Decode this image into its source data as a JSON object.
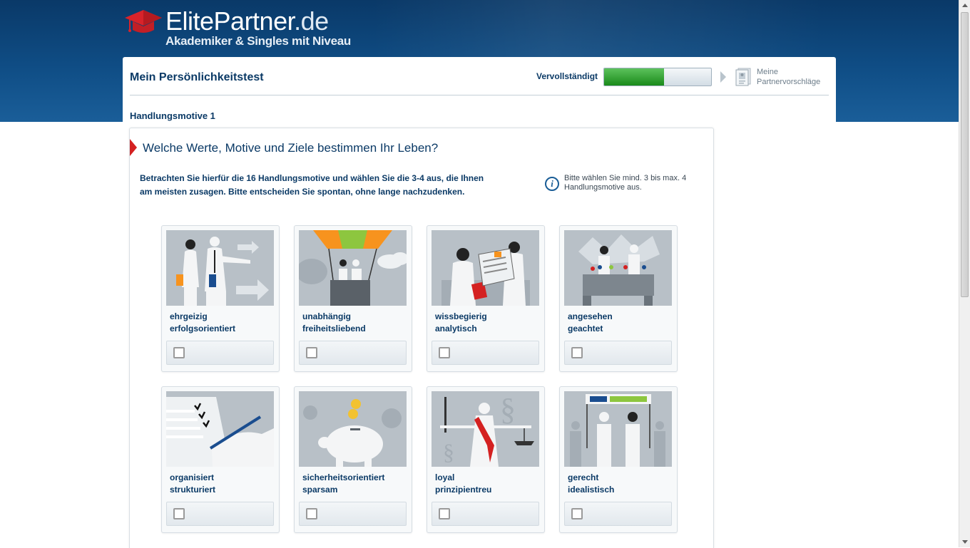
{
  "header": {
    "brand_main": "ElitePartner",
    "brand_ext": ".de",
    "slogan": "Akademiker & Singles mit Niveau"
  },
  "panel": {
    "title": "Mein Persönlichkeitstest",
    "progress_label": "Vervollständigt",
    "progress": 0.56,
    "next_step_line1": "Meine",
    "next_step_line2": "Partnervorschläge"
  },
  "section": {
    "title": "Handlungsmotive 1"
  },
  "question": {
    "title": "Welche Werte, Motive und Ziele bestimmen Ihr Leben?",
    "instruction_line1": "Betrachten Sie hierfür die 16 Handlungsmotive und wählen Sie die 3-4 aus, die Ihnen",
    "instruction_line2": "am meisten zusagen. Bitte entscheiden Sie spontan, ohne lange nachzudenken.",
    "hint_line1": "Bitte wählen Sie mind. 3 bis max. 4",
    "hint_line2": "Handlungsmotive aus."
  },
  "motives": [
    {
      "line1": "ehrgeizig",
      "line2": "erfolgsorientiert",
      "checked": false
    },
    {
      "line1": "unabhängig",
      "line2": "freiheitsliebend",
      "checked": false
    },
    {
      "line1": "wissbegierig",
      "line2": "analytisch",
      "checked": false
    },
    {
      "line1": "angesehen",
      "line2": "geachtet",
      "checked": false
    },
    {
      "line1": "organisiert",
      "line2": "strukturiert",
      "checked": false
    },
    {
      "line1": "sicherheitsorientiert",
      "line2": "sparsam",
      "checked": false
    },
    {
      "line1": "loyal",
      "line2": "prinzipientreu",
      "checked": false
    },
    {
      "line1": "gerecht",
      "line2": "idealistisch",
      "checked": false
    }
  ]
}
